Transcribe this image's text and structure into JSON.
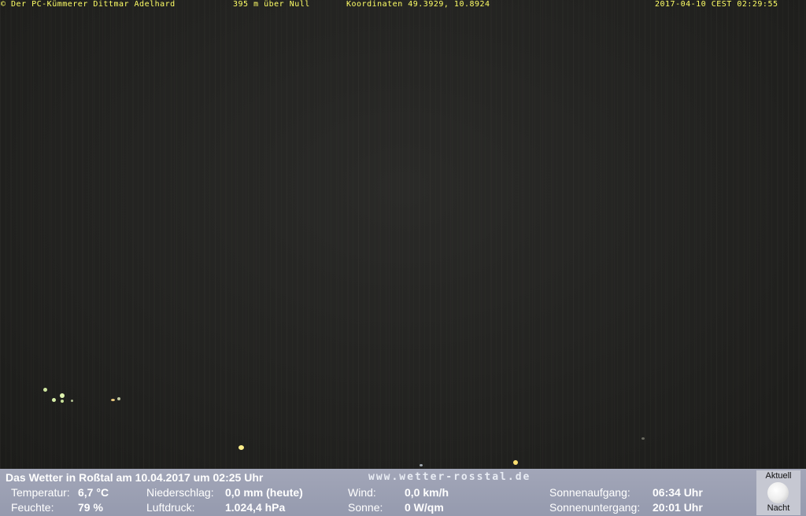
{
  "overlay": {
    "copyright": "© Der PC-Kümmerer Dittmar Adelhard",
    "altitude": "395 m über Null",
    "coordinates": "Koordinaten 49.3929, 10.8924",
    "timestamp": "2017-04-10 CEST 02:29:55"
  },
  "panel": {
    "title": "Das Wetter in Roßtal am 10.04.2017 um 02:25 Uhr",
    "website": "www.wetter-rosstal.de",
    "temperature_label": "Temperatur:",
    "temperature_value": "6,7 °C",
    "humidity_label": "Feuchte:",
    "humidity_value": "79 %",
    "precip_label": "Niederschlag:",
    "precip_value": "0,0 mm (heute)",
    "pressure_label": "Luftdruck:",
    "pressure_value": "1.024,4 hPa",
    "wind_label": "Wind:",
    "wind_value": "0,0 km/h",
    "sun_label": "Sonne:",
    "sun_value": "0 W/qm",
    "sunrise_label": "Sonnenaufgang:",
    "sunrise_value": "06:34 Uhr",
    "sunset_label": "Sonnenuntergang:",
    "sunset_value": "20:01 Uhr"
  },
  "moon": {
    "label_top": "Aktuell",
    "label_bottom": "Nacht",
    "icon": "full-moon-icon"
  },
  "colors": {
    "overlay_text": "#ffff66",
    "panel_bg": "#9a9fb3",
    "moonbox_bg": "#c6c8d2"
  }
}
